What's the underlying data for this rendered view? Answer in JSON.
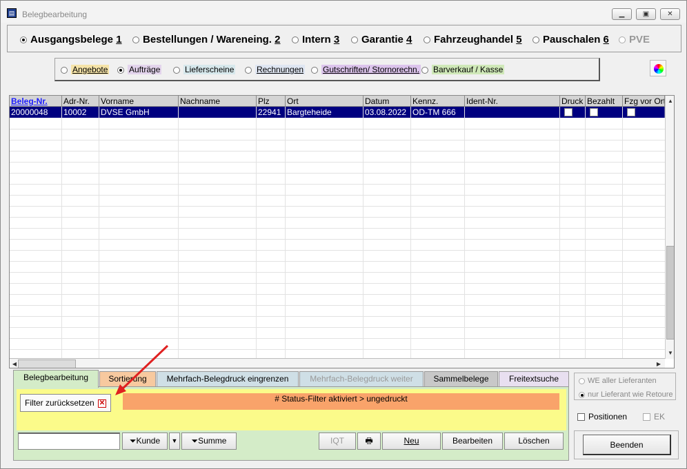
{
  "window": {
    "title": "Belegbearbeitung",
    "icon": "app-icon",
    "controls": [
      "minimize-icon",
      "restore-icon",
      "close-icon"
    ]
  },
  "main_types": [
    {
      "label": "Ausgangsbelege",
      "key": "1",
      "selected": true,
      "enabled": true
    },
    {
      "label": "Bestellungen / Wareneing.",
      "key": "2",
      "selected": false,
      "enabled": true
    },
    {
      "label": "Intern",
      "key": "3",
      "selected": false,
      "enabled": true
    },
    {
      "label": "Garantie",
      "key": "4",
      "selected": false,
      "enabled": true
    },
    {
      "label": "Fahrzeughandel",
      "key": "5",
      "selected": false,
      "enabled": true
    },
    {
      "label": "Pauschalen",
      "key": "6",
      "selected": false,
      "enabled": true
    },
    {
      "label": "PVE",
      "key": "",
      "selected": false,
      "enabled": false
    }
  ],
  "sub_types": [
    {
      "label": "Angebote",
      "selected": false,
      "bg": "#f5e3a8"
    },
    {
      "label": "Aufträge",
      "selected": true,
      "bg": "#e3d4ec"
    },
    {
      "label": "Lieferscheine",
      "selected": false,
      "bg": "#d7e8ec"
    },
    {
      "label": "Rechnungen",
      "selected": false,
      "bg": "#dfe6f2"
    },
    {
      "label": "Gutschriften/ Stornorechn.",
      "selected": false,
      "bg": "#dcc4ec"
    },
    {
      "label": "Barverkauf / Kasse",
      "selected": false,
      "bg": "#cfe8b8"
    }
  ],
  "table": {
    "columns": [
      "Beleg-Nr.",
      "Adr-Nr.",
      "Vorname",
      "Nachname",
      "Plz",
      "Ort",
      "Datum",
      "Kennz.",
      "Ident-Nr.",
      "Druck",
      "Bezahlt",
      "Fzg vor Ort"
    ],
    "rows": [
      {
        "beleg_nr": "20000048",
        "adr_nr": "10002",
        "vorname": "DVSE GmbH",
        "nachname": "",
        "plz": "22941",
        "ort": "Bargteheide",
        "datum": "03.08.2022",
        "kennz": "OD-TM 666",
        "ident_nr": "",
        "druck": false,
        "bezahlt": false,
        "fzg_vor_ort": false
      }
    ]
  },
  "tabs": [
    {
      "label": "Belegbearbeitung",
      "active": true,
      "enabled": true,
      "bg": "#d4ecc8"
    },
    {
      "label": "Sortierung",
      "active": false,
      "enabled": true,
      "bg": "#f7c99f"
    },
    {
      "label": "Mehrfach-Belegdruck eingrenzen",
      "active": false,
      "enabled": true,
      "bg": "#cfdfe6"
    },
    {
      "label": "Mehrfach-Belegdruck weiter",
      "active": false,
      "enabled": false,
      "bg": "#cfdfe6"
    },
    {
      "label": "Sammelbelege",
      "active": false,
      "enabled": true,
      "bg": "#c8c8c8"
    },
    {
      "label": "Freitextsuche",
      "active": false,
      "enabled": true,
      "bg": "#e8dff0"
    }
  ],
  "filter": {
    "reset_label": "Filter zurücksetzen",
    "status_text": "# Status-Filter aktiviert >  ungedruckt"
  },
  "bottom_buttons": {
    "kunde": "Kunde",
    "summe": "Summe",
    "iqt": "IQT",
    "neu": "Neu",
    "bearbeiten": "Bearbeiten",
    "loeschen": "Löschen"
  },
  "search_input": {
    "value": "",
    "placeholder": ""
  },
  "right_panel": {
    "we_aller": "WE aller Lieferanten",
    "nur_lieferant": "nur Lieferant wie Retoure",
    "positionen": "Positionen",
    "ek": "EK",
    "beenden": "Beenden"
  }
}
